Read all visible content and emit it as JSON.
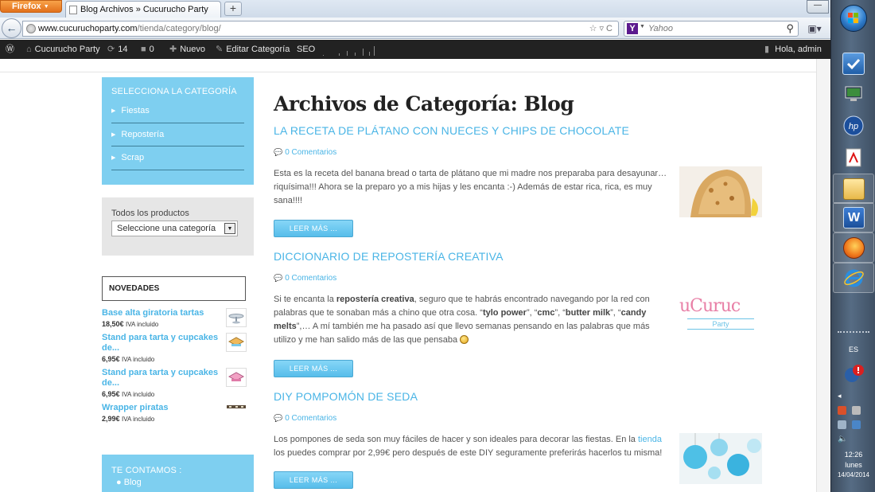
{
  "browser": {
    "menu_button": "Firefox",
    "tab_title": "Blog Archivos » Cucurucho Party",
    "new_tab_symbol": "+",
    "url_host": "www.cucuruchoparty.com",
    "url_path": "/tienda/category/blog/",
    "search_placeholder": "Yahoo",
    "search_engine_letter": "Y"
  },
  "adminbar": {
    "site_name": "Cucurucho Party",
    "updates_count": "14",
    "comments_count": "0",
    "new_label": "Nuevo",
    "edit_label": "Editar Categoría",
    "seo_label": "SEO",
    "greeting": "Hola, admin"
  },
  "sidebar": {
    "categories": {
      "title": "Selecciona la categoría",
      "items": [
        "Fiestas",
        "Repostería",
        "Scrap"
      ]
    },
    "products": {
      "label": "Todos los productos",
      "select_value": "Seleccione una categoría"
    },
    "novedades": {
      "title": "NOVEDADES",
      "items": [
        {
          "name": "Base alta giratoria tartas",
          "price": "18,50€",
          "tax": "IVA incluido"
        },
        {
          "name": "Stand para tarta y cupcakes de...",
          "price": "6,95€",
          "tax": "IVA incluido"
        },
        {
          "name": "Stand para tarta y cupcakes de...",
          "price": "6,95€",
          "tax": "IVA incluido"
        },
        {
          "name": "Wrapper piratas",
          "price": "2,99€",
          "tax": "IVA incluido"
        }
      ]
    },
    "contamos": {
      "title": "TE CONTAMOS :",
      "items": [
        "Blog"
      ]
    }
  },
  "main": {
    "page_title": "Archivos de Categoría: Blog",
    "posts": [
      {
        "title": "LA RECETA DE PLÁTANO CON NUECES Y CHIPS DE CHOCOLATE",
        "comments": "0 Comentarios",
        "excerpt": "Esta es la receta del banana bread o tarta de plátano que mi madre nos preparaba para desayunar…riquísima!!! Ahora se la preparo yo a mis hijas y les encanta :-)  Además de estar rica, rica, es muy sana!!!!",
        "read_more": "LEER MÁS ..."
      },
      {
        "title": "DICCIONARIO DE REPOSTERÍA CREATIVA",
        "comments": "0 Comentarios",
        "excerpt_parts": {
          "p1": "Si te encanta la ",
          "b1": "repostería creativa",
          "p2": ", seguro que te habrás encontrado navegando por la red con palabras que te sonaban más a chino que otra cosa. “",
          "b2": "tylo power",
          "p3": "”, “",
          "b3": "cmc",
          "p4": "”, “",
          "b4": "butter milk",
          "p5": "”, “",
          "b5": "candy melts",
          "p6": "”,… A mí también me ha pasado así que llevo semanas pensando en las palabras que más utilizo  y me han salido más de las que pensaba "
        },
        "read_more": "LEER MÁS ...",
        "logo_text": "uCuruc",
        "logo_sub": "Party"
      },
      {
        "title": "DIY POMPOMÓN DE SEDA",
        "comments": "0 Comentarios",
        "excerpt_parts": {
          "p1": "Los pompones de seda son muy fáciles de hacer y son ideales para decorar las fiestas. En la ",
          "link": "tienda",
          "p2": " los puedes comprar por 2,99€ pero después de este DIY seguramente preferirás hacerlos tu misma!"
        },
        "read_more": "LEER MÁS ..."
      }
    ]
  },
  "taskbar": {
    "language": "ES",
    "time": "12:26",
    "day": "lunes",
    "date": "14/04/2014"
  },
  "colors": {
    "accent": "#4ab5e6",
    "widget_bg": "#7ecff0",
    "adminbar_bg": "#222222"
  }
}
